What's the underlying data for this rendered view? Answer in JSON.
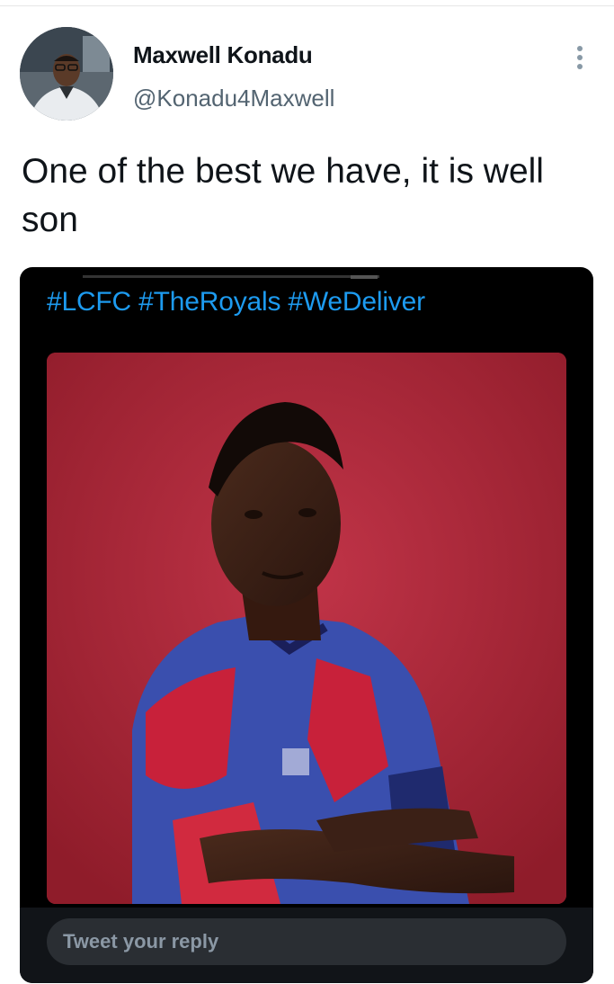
{
  "tweet": {
    "author_name": "Maxwell Konadu",
    "author_handle": "@Konadu4Maxwell",
    "text": "One of the best we have, it is well son"
  },
  "card": {
    "hashtags": "#LCFC #TheRoyals #WeDeliver",
    "reply_placeholder": "Tweet your reply"
  },
  "colors": {
    "hashtag": "#1d9bf0",
    "handle": "#536471",
    "photo_background": "#b32a3a"
  },
  "icons": {
    "more": "more-vertical-icon",
    "avatar": "avatar"
  }
}
